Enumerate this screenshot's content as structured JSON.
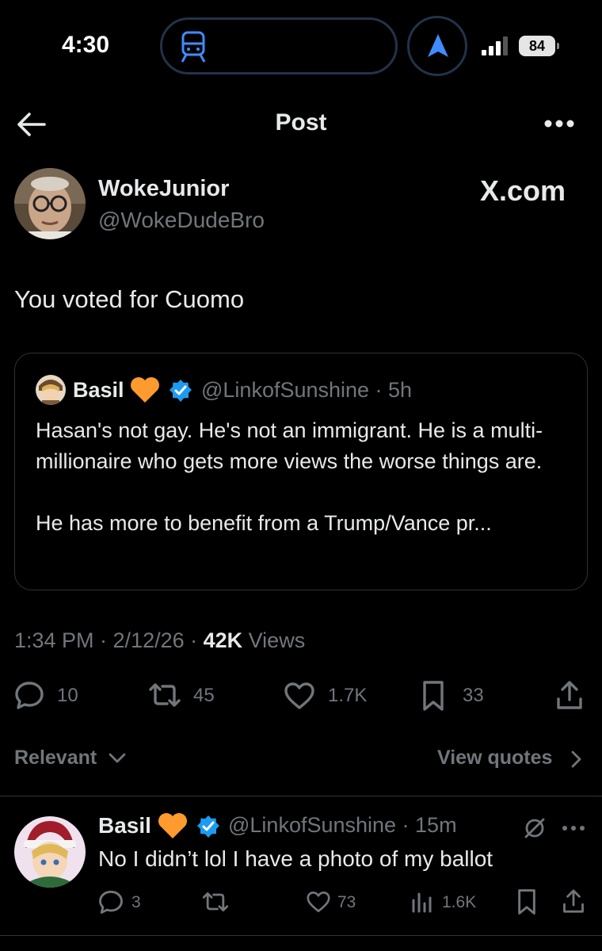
{
  "status_bar": {
    "time": "4:30",
    "battery": "84"
  },
  "header": {
    "title": "Post"
  },
  "post": {
    "author_name": "WokeJunior",
    "author_handle": "@WokeDudeBro",
    "source_label": "X.com",
    "text": "You voted for Cuomo",
    "quote": {
      "name": "Basil",
      "handle_time": "@LinkofSunshine · 5h",
      "text": "Hasan's not gay. He's not an immigrant. He is a multi-millionaire who gets more views the worse things are.\n\nHe has more to benefit from a Trump/Vance pr..."
    },
    "time_date": "1:34 PM · 2/12/26 · ",
    "views_count": "42K",
    "views_label": " Views",
    "actions": {
      "replies": "10",
      "reposts": "45",
      "likes": "1.7K",
      "bookmarks": "33"
    }
  },
  "replies_bar": {
    "sort_label": "Relevant",
    "view_quotes_label": "View quotes"
  },
  "reply": {
    "name": "Basil",
    "handle_time": "@LinkofSunshine · 15m",
    "text": "No I didn’t lol I have a photo of my ballot",
    "actions": {
      "replies": "3",
      "likes": "73",
      "views": "1.6K"
    }
  },
  "colors": {
    "accent": "#1d9bf0",
    "grey": "#71767b",
    "heart": "#ff9a2e"
  },
  "icons": [
    "train-icon",
    "location-arrow-icon",
    "signal-icon",
    "back-arrow-icon",
    "more-icon",
    "verified-icon",
    "orange-heart-icon",
    "reply-icon",
    "repost-icon",
    "like-icon",
    "bookmark-icon",
    "share-icon",
    "chevron-down-icon",
    "chevron-right-icon",
    "views-icon",
    "mute-icon"
  ]
}
